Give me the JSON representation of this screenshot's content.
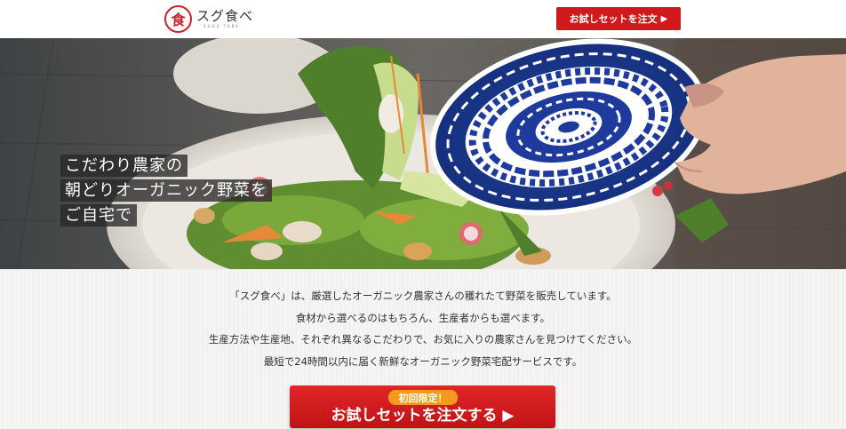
{
  "header": {
    "logo_mark": "食",
    "logo_name": "スグ食べ",
    "logo_sub": "SUGU TABE",
    "cta_label": "お試しセットを注文",
    "cta_arrow": "▶"
  },
  "hero": {
    "catch_lines": [
      "こだわり農家の",
      "朝どりオーガニック野菜を",
      "ご自宅で"
    ]
  },
  "intro": {
    "lines": [
      "「スグ食べ」は、厳選したオーガニック農家さんの穫れたて野菜を販売しています。",
      "食材から選べるのはもちろん、生産者からも選べます。",
      "生産方法や生産地、それぞれ異なるこだわりで、お気に入りの農家さんを見つけてください。",
      "最短で24時間以内に届く新鮮なオーガニック野菜宅配サービスです。"
    ],
    "badge": "初回限定！",
    "cta_label": "お試しセットを注文する ▶"
  },
  "colors": {
    "brand_red": "#d0191c",
    "badge_orange": "#f39a1e",
    "plate_blue": "#1e3a9c"
  }
}
